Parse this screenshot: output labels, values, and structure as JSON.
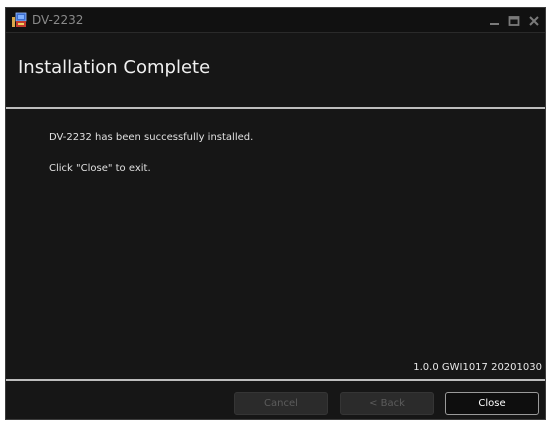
{
  "window": {
    "title": "DV-2232",
    "icon": "installer-app-icon",
    "controls": {
      "minimize": "minimize-icon",
      "maximize": "maximize-icon",
      "close": "close-icon"
    }
  },
  "header": {
    "title": "Installation Complete"
  },
  "body": {
    "line1": "DV-2232 has been successfully installed.",
    "line2": "Click \"Close\" to exit."
  },
  "footer": {
    "version": "1.0.0 GWI1017 20201030",
    "buttons": {
      "cancel": {
        "label": "Cancel",
        "enabled": false
      },
      "back": {
        "label": "< Back",
        "enabled": false
      },
      "close": {
        "label": "Close",
        "enabled": true
      }
    }
  },
  "colors": {
    "background": "#161616",
    "divider": "#bdbdbd",
    "text": "#e0e0e0",
    "title_text": "#8a8a8a",
    "disabled_text": "#5c5c5c"
  }
}
